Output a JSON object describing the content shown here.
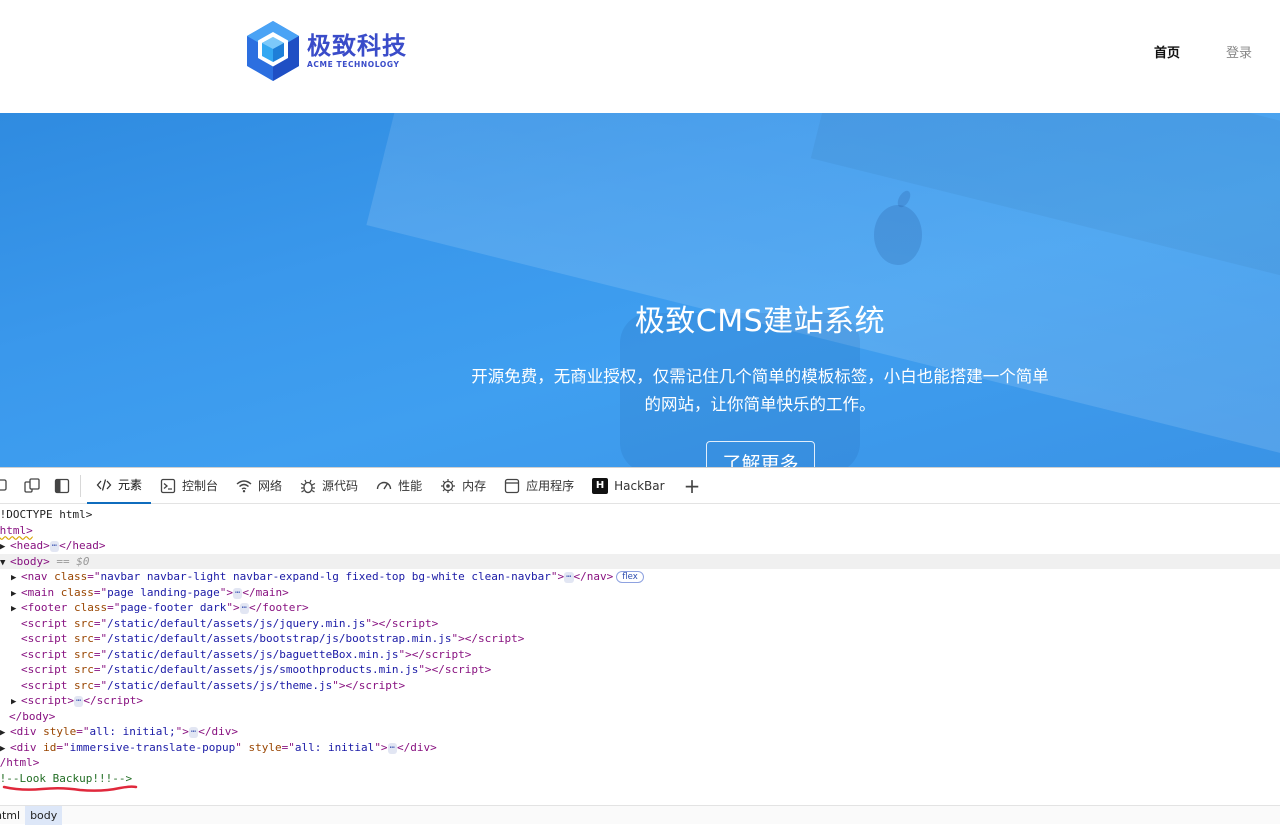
{
  "site": {
    "logo_cn": "极致科技",
    "logo_en": "ACME TECHNOLOGY",
    "nav": [
      {
        "label": "首页",
        "active": true
      },
      {
        "label": "登录",
        "active": false
      }
    ]
  },
  "hero": {
    "title": "极致CMS建站系统",
    "subtitle_line1": "开源免费，无商业授权，仅需记住几个简单的模板标签，小白也能搭建一个简单",
    "subtitle_line2": "的网站，让你简单快乐的工作。",
    "button": "了解更多"
  },
  "devtools": {
    "tabs": [
      {
        "label": "元素",
        "icon": "code-icon",
        "active": true
      },
      {
        "label": "控制台",
        "icon": "console-icon",
        "active": false
      },
      {
        "label": "网络",
        "icon": "wifi-icon",
        "active": false
      },
      {
        "label": "源代码",
        "icon": "bug-icon",
        "active": false
      },
      {
        "label": "性能",
        "icon": "gauge-icon",
        "active": false
      },
      {
        "label": "内存",
        "icon": "cpu-icon",
        "active": false
      },
      {
        "label": "应用程序",
        "icon": "window-icon",
        "active": false
      },
      {
        "label": "HackBar",
        "icon": "hackbar-icon",
        "active": false
      }
    ],
    "dom": {
      "doctype": "<!DOCTYPE html>",
      "html_open": "<html>",
      "head": "head",
      "body_label": "body",
      "body_ref": "== $0",
      "nav_class": "navbar navbar-light navbar-expand-lg fixed-top bg-white clean-navbar",
      "nav_badge": "flex",
      "main_class": "page landing-page",
      "footer_class": "page-footer dark",
      "scripts": [
        "/static/default/assets/js/jquery.min.js",
        "/static/default/assets/bootstrap/js/bootstrap.min.js",
        "/static/default/assets/js/baguetteBox.min.js",
        "/static/default/assets/js/smoothproducts.min.js",
        "/static/default/assets/js/theme.js"
      ],
      "div1_style": "all: initial;",
      "div2_id": "immersive-translate-popup",
      "div2_style": "all: initial",
      "html_close": "</html>",
      "comment": "<!--Look Backup!!!-->"
    },
    "breadcrumbs": [
      "html",
      "body"
    ]
  },
  "colors": {
    "hero_blue": "#3a98ec",
    "logo_blue": "#3a4cc9",
    "annotation_red": "#e0283c"
  }
}
